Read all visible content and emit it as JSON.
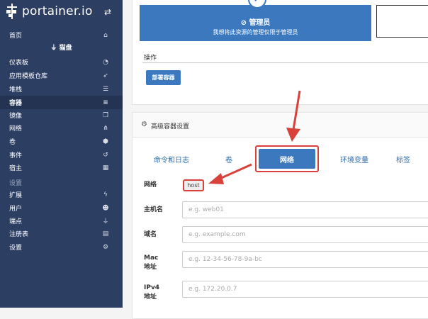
{
  "app": {
    "logo_text": "portainer.io",
    "accent_color": "#3b78bd",
    "sidebar_color": "#2d3e63",
    "highlight_color": "#d9423b"
  },
  "sidebar": {
    "home": "首页",
    "endpoint": "猫盘",
    "items": [
      {
        "label": "仪表板",
        "icon": "tachometer-icon"
      },
      {
        "label": "应用模板仓库",
        "icon": "rocket-icon"
      },
      {
        "label": "堆栈",
        "icon": "list-icon"
      },
      {
        "label": "容器",
        "icon": "server-icon",
        "active": true
      },
      {
        "label": "镜像",
        "icon": "clone-icon"
      },
      {
        "label": "网络",
        "icon": "sitemap-icon"
      },
      {
        "label": "卷",
        "icon": "cubes-icon"
      },
      {
        "label": "事件",
        "icon": "history-icon"
      },
      {
        "label": "宿主",
        "icon": "th-icon"
      }
    ],
    "settings_section": "设置",
    "settings_items": [
      {
        "label": "扩展",
        "icon": "bolt-icon"
      },
      {
        "label": "用户",
        "icon": "users-icon"
      },
      {
        "label": "端点",
        "icon": "plug-icon"
      },
      {
        "label": "注册表",
        "icon": "database-icon"
      },
      {
        "label": "设置",
        "icon": "cogs-icon"
      }
    ]
  },
  "access": {
    "admin_title": "管理员",
    "admin_desc": "我想将此资源的管理仅限于管理员"
  },
  "actions": {
    "label": "操作",
    "deploy_button": "部署容器"
  },
  "advanced": {
    "title": "高级容器设置",
    "tabs": [
      "命令和日志",
      "卷",
      "网络",
      "环境变量",
      "标签"
    ],
    "active_tab": "网络"
  },
  "network_form": {
    "network_label": "网络",
    "network_value": "host",
    "hostname_label": "主机名",
    "hostname_placeholder": "e.g. web01",
    "domain_label": "域名",
    "domain_placeholder": "e.g. example.com",
    "mac_label_1": "Mac",
    "mac_label_2": "地址",
    "mac_placeholder": "e.g. 12-34-56-78-9a-bc",
    "ipv4_label_1": "IPv4",
    "ipv4_label_2": "地址",
    "ipv4_placeholder": "e.g. 172.20.0.7"
  }
}
